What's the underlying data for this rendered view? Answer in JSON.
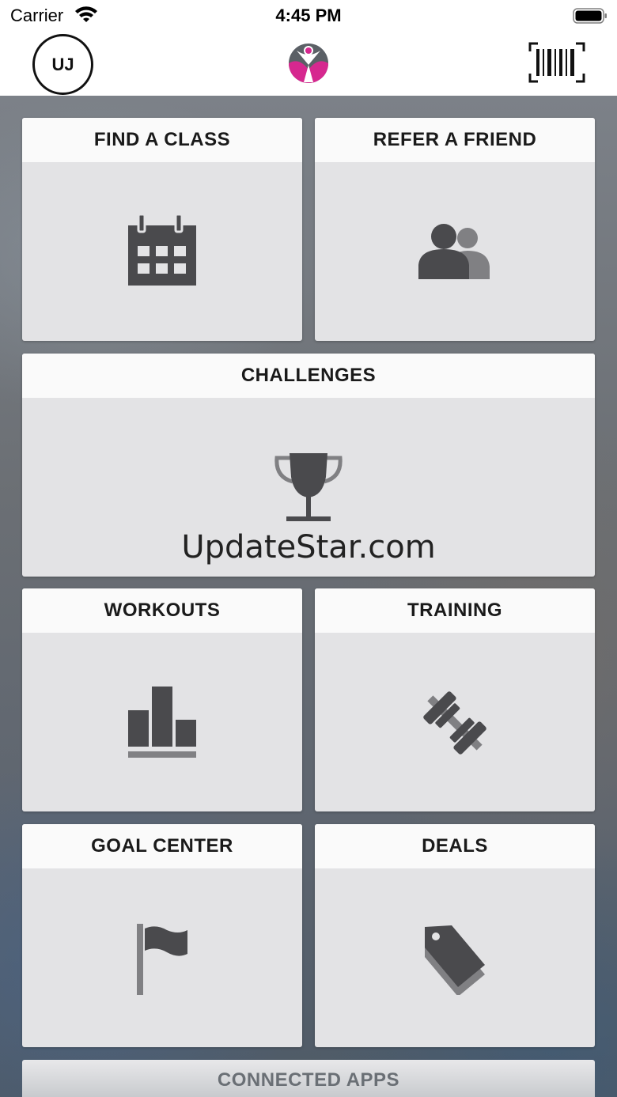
{
  "status_bar": {
    "carrier": "Carrier",
    "time": "4:45 PM"
  },
  "nav": {
    "avatar_initials": "UJ"
  },
  "tiles": {
    "find_class": "FIND A CLASS",
    "refer_friend": "REFER A FRIEND",
    "challenges": "CHALLENGES",
    "workouts": "WORKOUTS",
    "training": "TRAINING",
    "goal_center": "GOAL CENTER",
    "deals": "DEALS",
    "connected_apps": "CONNECTED APPS"
  },
  "watermark": "UpdateStar.com",
  "colors": {
    "icon": "#4a4a4d",
    "icon_secondary": "#808083",
    "logo_pink": "#d6288f",
    "logo_gray": "#5b6066"
  }
}
